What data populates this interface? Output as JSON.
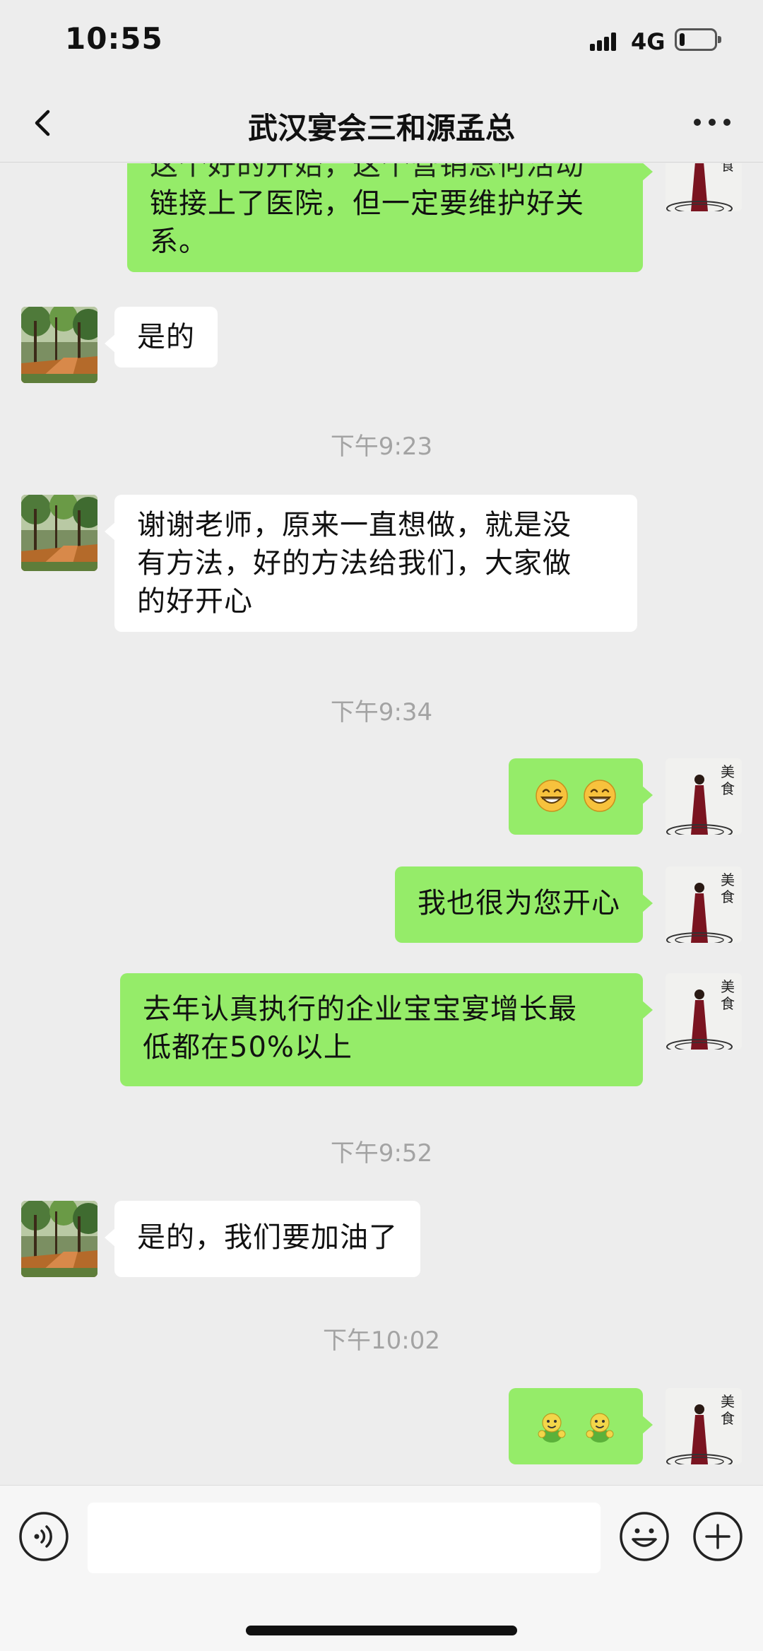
{
  "status_bar": {
    "time": "10:55",
    "network": "4G",
    "battery_level": 0.15
  },
  "header": {
    "title": "武汉宴会三和源孟总",
    "back_icon": "chevron-left-icon",
    "more_icon": "more-dots-icon"
  },
  "colors": {
    "background": "#ededed",
    "outgoing_bubble": "#95ec69",
    "incoming_bubble": "#ffffff",
    "timestamp": "#a3a3a3"
  },
  "messages": [
    {
      "type": "out",
      "text": "这个好的开始，这个营销思何活动链接上了医院，但一定要维护好关系。",
      "visible_text": "链接上了医院，但一定要维护好关系。"
    },
    {
      "type": "in",
      "text": "是的"
    },
    {
      "type": "time",
      "text": "下午9:23"
    },
    {
      "type": "in",
      "text": "谢谢老师，原来一直想做，就是没有方法，好的方法给我们，大家做的好开心"
    },
    {
      "type": "time",
      "text": "下午9:34"
    },
    {
      "type": "out",
      "emoji": [
        "grin-emoji",
        "grin-emoji"
      ]
    },
    {
      "type": "out",
      "text": "我也很为您开心"
    },
    {
      "type": "out",
      "text": "去年认真执行的企业宝宝宴增长最低都在50%以上"
    },
    {
      "type": "time",
      "text": "下午9:52"
    },
    {
      "type": "in",
      "text": "是的，我们要加油了"
    },
    {
      "type": "time",
      "text": "下午10:02"
    },
    {
      "type": "out",
      "emoji": [
        "fist-bump-emoji",
        "fist-bump-emoji"
      ]
    }
  ],
  "msg0_line2": "链接上了医院，但一定要维护好关",
  "msg0_line3": "系。",
  "msg3_line1": "谢谢老师，原来一直想做，就是没",
  "msg3_line2": "有方法，好的方法给我们，大家做",
  "msg3_line3": "的好开心",
  "msg7_line1": "去年认真执行的企业宝宝宴增长最",
  "msg7_line2": "低都在50%以上",
  "input_bar": {
    "voice_icon": "voice-icon",
    "input_value": "",
    "emoji_icon": "emoji-icon",
    "plus_icon": "plus-icon"
  }
}
